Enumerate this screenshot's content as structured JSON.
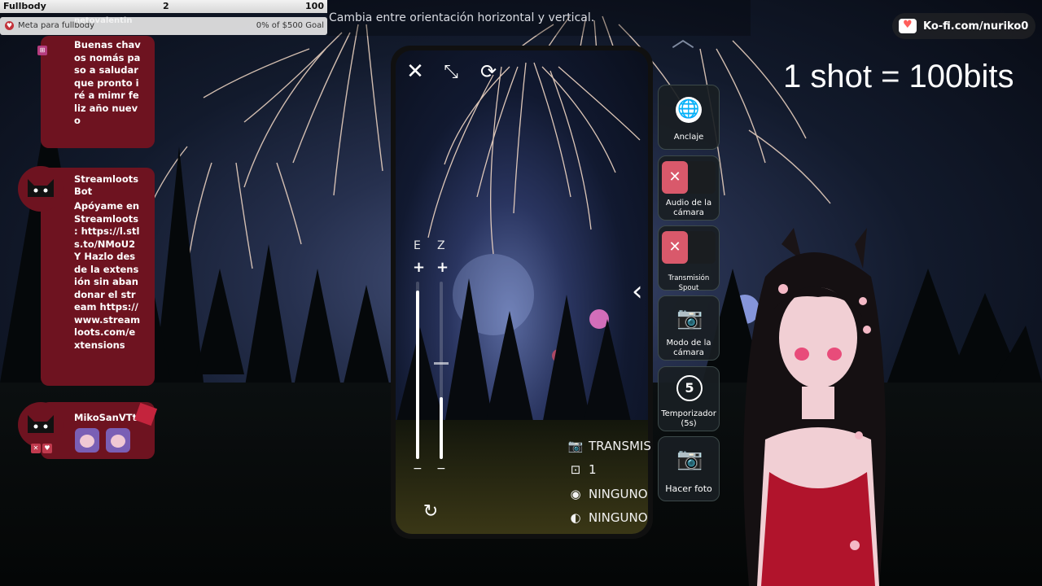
{
  "goal": {
    "name": "Fullbody",
    "current": "2",
    "target": "100",
    "progress": 0.02
  },
  "goal_meta": {
    "label": "Meta para fullbody",
    "status": "0% of $500 Goal"
  },
  "notice": "Cambia entre orientación horizontal y vertical.",
  "chat": [
    {
      "partial_top": "netovalentin",
      "text": "Buenas chavos nomás paso a saludar que pronto iré a mimr feliz año nuevo"
    },
    {
      "name": "StreamlootsBot",
      "text": "Apóyame en Streamloots : https://l.stls.to/NMoU2Y Hazlo desde la extensión sin abandonar el stream https://www.streamloots.com/extensions"
    },
    {
      "name": "MikoSanVTt"
    }
  ],
  "phone": {
    "slider_left_label": "E",
    "slider_right_label": "Z",
    "plus": "+",
    "minus": "−",
    "slider_left_value": 0.95,
    "slider_right_value": 0.35,
    "info": [
      {
        "icon": "camera-icon",
        "text": "TRANSMIS"
      },
      {
        "icon": "count-icon",
        "text": "1"
      },
      {
        "icon": "aperture-icon",
        "text": "NINGUNO"
      },
      {
        "icon": "filter-icon",
        "text": "NINGUNO"
      }
    ]
  },
  "side_buttons": {
    "anchor": "Anclaje",
    "camera_audio": "Audio de la cámara",
    "spout": "Transmisión Spout",
    "camera_mode": "Modo de la cámara",
    "timer": "Temporizador (5s)",
    "timer_value": "5",
    "take_photo": "Hacer foto"
  },
  "kofi": "Ko-fi.com/nuriko0",
  "overlay_text": "1 shot = 100bits"
}
